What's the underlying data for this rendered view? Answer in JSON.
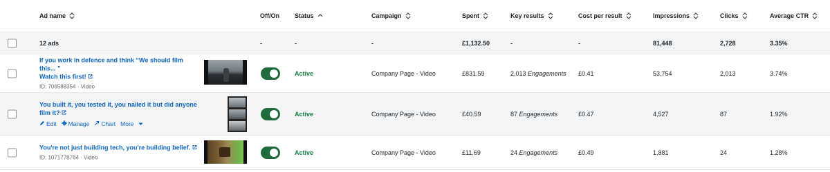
{
  "columns": {
    "ad_name": "Ad name",
    "off_on": "Off/On",
    "status": "Status",
    "campaign": "Campaign",
    "spent": "Spent",
    "key_results": "Key results",
    "cost_per_result": "Cost per result",
    "impressions": "Impressions",
    "clicks": "Clicks",
    "avg_ctr": "Average CTR"
  },
  "summary": {
    "ad_name": "12 ads",
    "off_on": "-",
    "status": "-",
    "campaign": "-",
    "spent": "£1,132.50",
    "key_results": "-",
    "cost_per_result": "-",
    "impressions": "81,448",
    "clicks": "2,728",
    "avg_ctr": "3.35%"
  },
  "rows": [
    {
      "name_line1": "If you work in defence and think “We should film this... ”",
      "name_line2": "Watch this first!",
      "sub": "ID: 706588354 · Video",
      "status": "Active",
      "toggle_on": true,
      "campaign": "Company Page - Video",
      "spent": "£831.59",
      "key_results_value": "2,013",
      "key_results_label": "Engagements",
      "cost_per_result": "£0.41",
      "impressions": "53,754",
      "clicks": "2,013",
      "avg_ctr": "3.74%"
    },
    {
      "name_line1": "You built it, you tested it, you nailed it but did anyone",
      "name_line2": "film it?",
      "actions": {
        "edit": "Edit",
        "manage": "Manage",
        "chart": "Chart",
        "more": "More"
      },
      "status": "Active",
      "toggle_on": true,
      "campaign": "Company Page - Video",
      "spent": "£40.59",
      "key_results_value": "87",
      "key_results_label": "Engagements",
      "cost_per_result": "£0.47",
      "impressions": "4,527",
      "clicks": "87",
      "avg_ctr": "1.92%"
    },
    {
      "name_line1": "You're not just building tech, you're building belief.",
      "sub": "ID: 1071778764 · Video",
      "status": "Active",
      "toggle_on": true,
      "campaign": "Company Page - Video",
      "spent": "£11.69",
      "key_results_value": "24",
      "key_results_label": "Engagements",
      "cost_per_result": "£0.49",
      "impressions": "1,881",
      "clicks": "24",
      "avg_ctr": "1.28%"
    }
  ],
  "colors": {
    "link": "#0a66c2",
    "active": "#138043",
    "toggle": "#1f6b3a",
    "row_alt": "#f4f5f6"
  },
  "icons": {
    "sort": "sort-arrows-icon",
    "external": "external-link-icon",
    "edit": "pencil-icon",
    "manage": "gear-icon",
    "chart": "trend-icon",
    "more": "caret-down-icon"
  }
}
